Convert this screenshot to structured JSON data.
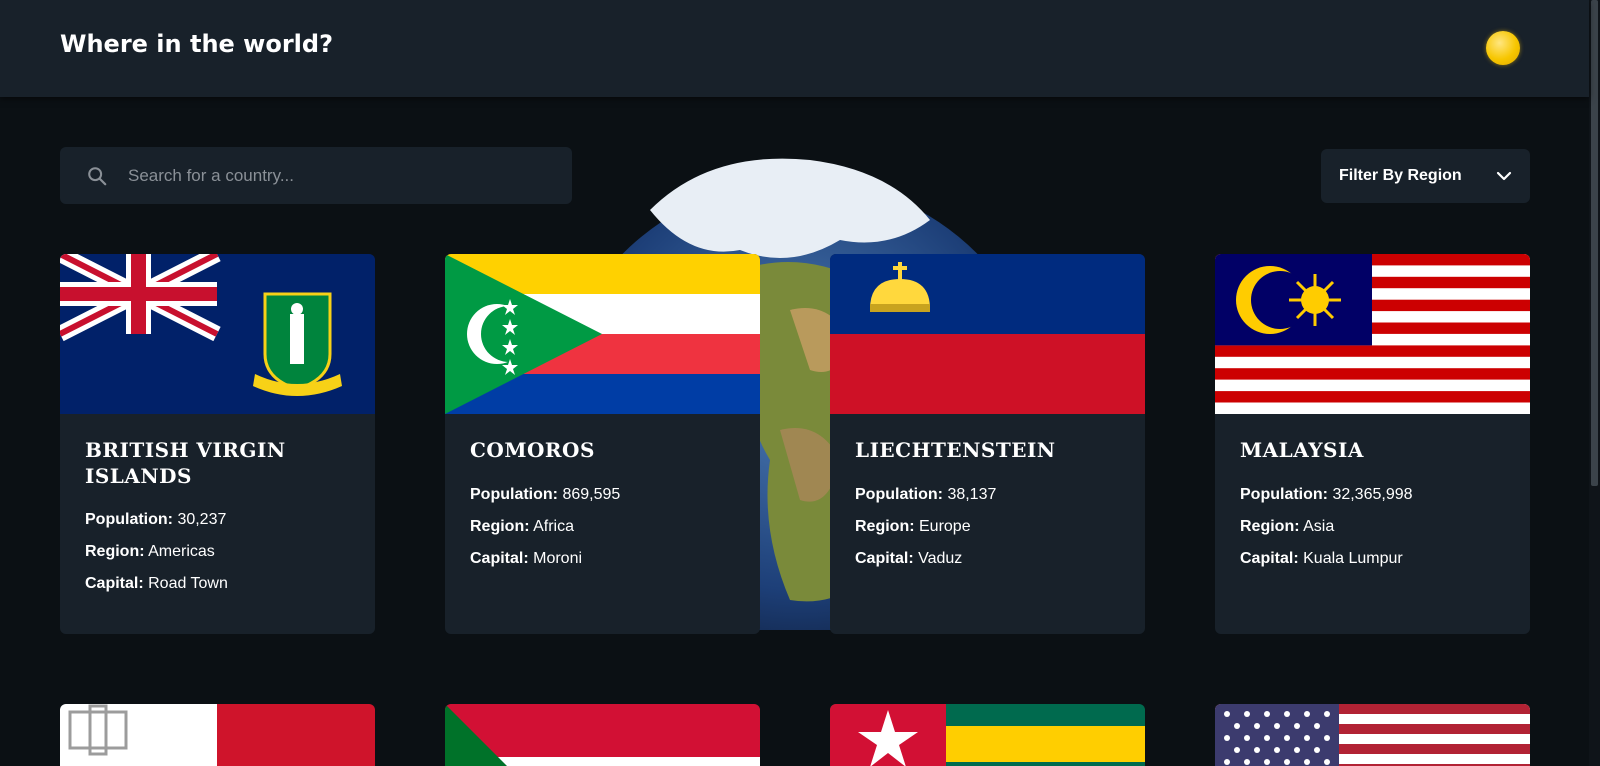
{
  "header": {
    "title": "Where in the world?",
    "theme_icon": "sun-icon"
  },
  "search": {
    "placeholder": "Search for a country...",
    "value": ""
  },
  "filter": {
    "label": "Filter By Region"
  },
  "labels": {
    "population": "Population:",
    "region": "Region:",
    "capital": "Capital:"
  },
  "countries": [
    {
      "name": "British Virgin Islands",
      "population": "30,237",
      "region": "Americas",
      "capital": "Road Town"
    },
    {
      "name": "Comoros",
      "population": "869,595",
      "region": "Africa",
      "capital": "Moroni"
    },
    {
      "name": "Liechtenstein",
      "population": "38,137",
      "region": "Europe",
      "capital": "Vaduz"
    },
    {
      "name": "Malaysia",
      "population": "32,365,998",
      "region": "Asia",
      "capital": "Kuala Lumpur"
    }
  ],
  "next_row_flags": [
    "Malta",
    "Sudan",
    "Togo",
    "United States"
  ],
  "colors": {
    "background": "#0b1014",
    "surface": "#18212a",
    "text": "#ffffff",
    "muted": "#8a9097"
  }
}
